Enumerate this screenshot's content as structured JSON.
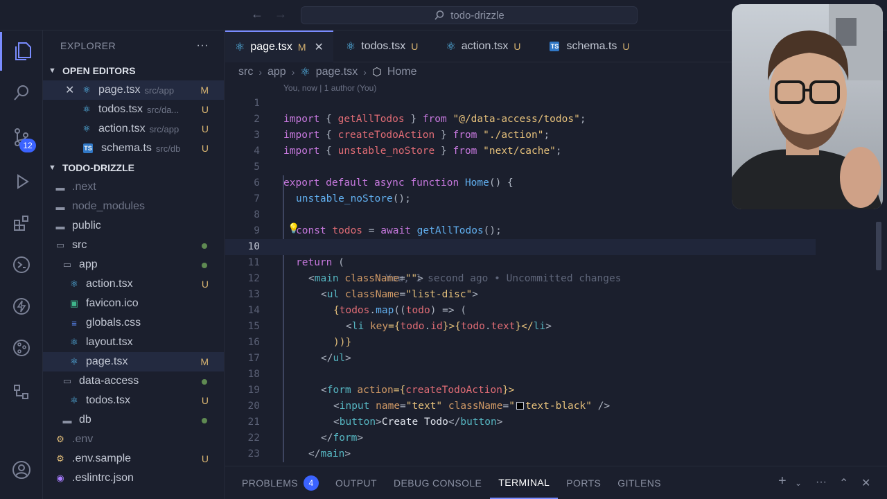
{
  "window": {
    "search_text": "todo-drizzle"
  },
  "activity_bar": {
    "scm_badge": "12"
  },
  "sidebar": {
    "title": "EXPLORER",
    "more": "···",
    "open_editors_title": "OPEN EDITORS",
    "open_editors": [
      {
        "name": "page.tsx",
        "path": "src/app",
        "status": "M",
        "icon": "react",
        "active": true
      },
      {
        "name": "todos.tsx",
        "path": "src/da...",
        "status": "U",
        "icon": "react"
      },
      {
        "name": "action.tsx",
        "path": "src/app",
        "status": "U",
        "icon": "react"
      },
      {
        "name": "schema.ts",
        "path": "src/db",
        "status": "U",
        "icon": "ts"
      }
    ],
    "project_title": "TODO-DRIZZLE",
    "tree": [
      {
        "name": ".next",
        "status": ""
      },
      {
        "name": "node_modules",
        "status": ""
      },
      {
        "name": "public",
        "status": ""
      },
      {
        "name": "src",
        "status": ""
      },
      {
        "name": "app",
        "status": ""
      },
      {
        "name": "action.tsx",
        "status": "U"
      },
      {
        "name": "favicon.ico",
        "status": ""
      },
      {
        "name": "globals.css",
        "status": ""
      },
      {
        "name": "layout.tsx",
        "status": ""
      },
      {
        "name": "page.tsx",
        "status": "M"
      },
      {
        "name": "data-access",
        "status": ""
      },
      {
        "name": "todos.tsx",
        "status": "U"
      },
      {
        "name": "db",
        "status": ""
      },
      {
        "name": ".env",
        "status": ""
      },
      {
        "name": ".env.sample",
        "status": "U"
      },
      {
        "name": ".eslintrc.json",
        "status": ""
      }
    ]
  },
  "tabs": [
    {
      "name": "page.tsx",
      "status": "M",
      "active": true
    },
    {
      "name": "todos.tsx",
      "status": "U"
    },
    {
      "name": "action.tsx",
      "status": "U"
    },
    {
      "name": "schema.ts",
      "status": "U"
    }
  ],
  "breadcrumb": [
    "src",
    "app",
    "page.tsx",
    "Home"
  ],
  "blame_header": "You, now | 1 author (You)",
  "inline_blame": "You, 1 second ago • Uncommitted changes",
  "line_numbers": [
    "1",
    "2",
    "3",
    "4",
    "5",
    "6",
    "7",
    "8",
    "9",
    "10",
    "11",
    "12",
    "13",
    "14",
    "15",
    "16",
    "17",
    "18",
    "19",
    "20",
    "21",
    "22",
    "23"
  ],
  "code": {
    "l1": [
      "import",
      " { ",
      "getAllTodos",
      " } ",
      "from",
      " ",
      "\"@/data-access/todos\"",
      ";"
    ],
    "l2": [
      "import",
      " { ",
      "createTodoAction",
      " } ",
      "from",
      " ",
      "\"./action\"",
      ";"
    ],
    "l3": [
      "import",
      " { ",
      "unstable_noStore",
      " } ",
      "from",
      " ",
      "\"next/cache\"",
      ";"
    ],
    "l5": [
      "export",
      " ",
      "default",
      " ",
      "async",
      " ",
      "function",
      " ",
      "Home",
      "() {"
    ],
    "l6": [
      "unstable_noStore",
      "();"
    ],
    "l8": [
      "const",
      " ",
      "todos",
      " = ",
      "await",
      " ",
      "getAllTodos",
      "();"
    ],
    "l10": [
      "return",
      " ("
    ],
    "l11": [
      "<",
      "main",
      " ",
      "className",
      "=",
      "\"\"",
      ">"
    ],
    "l12": [
      "<",
      "ul",
      " ",
      "className",
      "=",
      "\"list-disc\"",
      ">"
    ],
    "l13": [
      "{",
      "todos",
      ".",
      "map",
      "((",
      "todo",
      ") => ("
    ],
    "l14": [
      "<",
      "li",
      " ",
      "key",
      "={",
      "todo",
      ".",
      "id",
      "}>{",
      "todo",
      ".",
      "text",
      "}</",
      "li",
      ">"
    ],
    "l15": [
      "))}"
    ],
    "l16": [
      "</",
      "ul",
      ">"
    ],
    "l18": [
      "<",
      "form",
      " ",
      "action",
      "={",
      "createTodoAction",
      "}>"
    ],
    "l19": [
      "<",
      "input",
      " ",
      "name",
      "=",
      "\"text\"",
      " ",
      "className",
      "=",
      "\"",
      "text-black\"",
      " />"
    ],
    "l20": [
      "<",
      "button",
      ">",
      "Create Todo",
      "</",
      "button",
      ">"
    ],
    "l21": [
      "</",
      "form",
      ">"
    ],
    "l22": [
      "</",
      "main",
      ">"
    ],
    "l23": [
      ");"
    ]
  },
  "panel": {
    "tabs": [
      "PROBLEMS",
      "OUTPUT",
      "DEBUG CONSOLE",
      "TERMINAL",
      "PORTS",
      "GITLENS"
    ],
    "problems_count": "4",
    "active": "TERMINAL"
  }
}
